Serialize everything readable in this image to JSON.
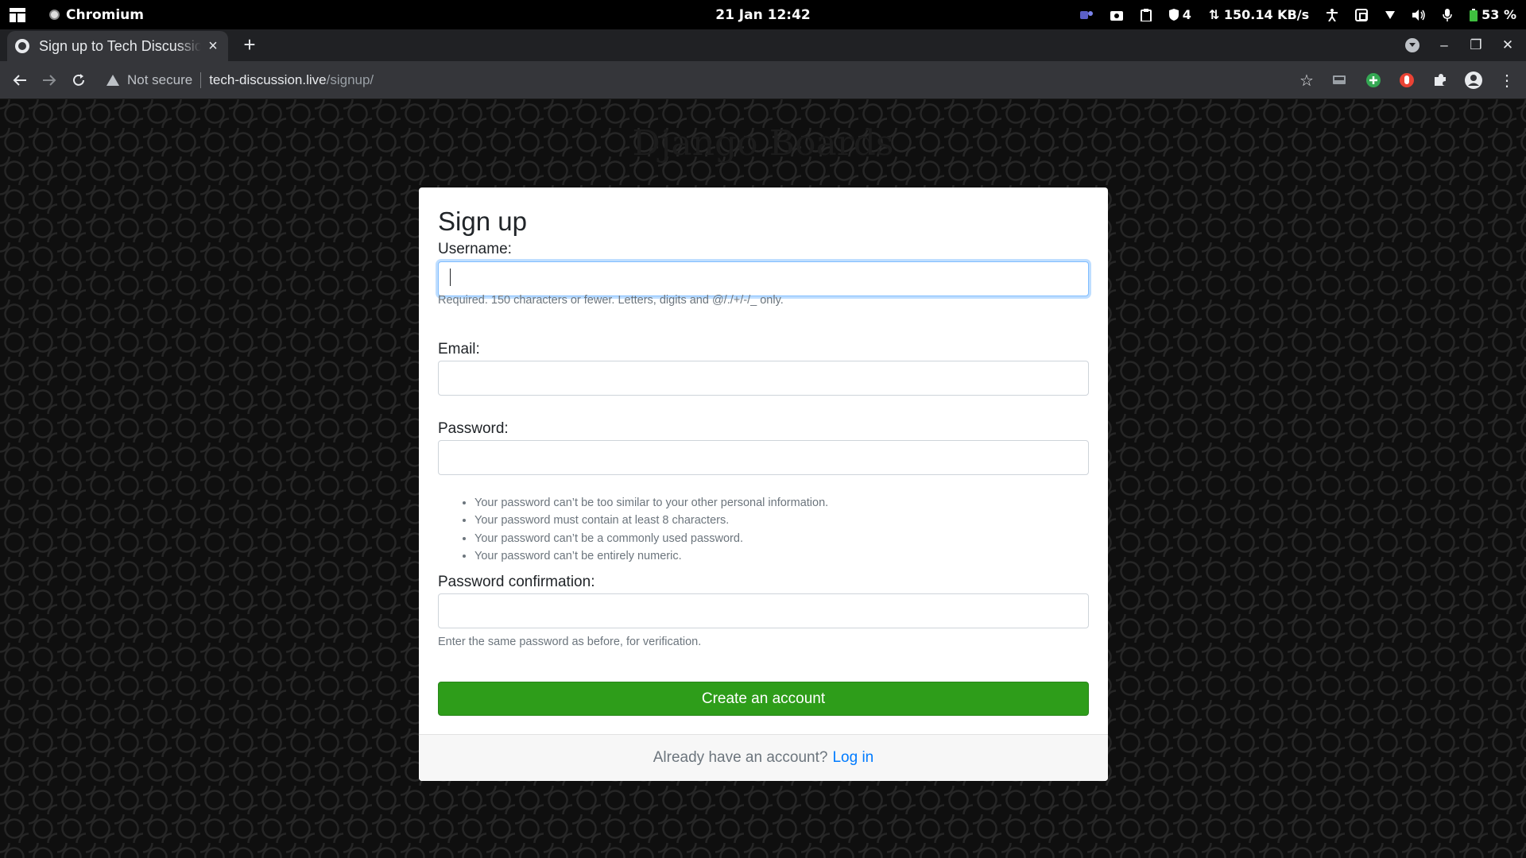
{
  "os_bar": {
    "active_app": "Chromium",
    "clock": "21 Jan  12:42",
    "tray": {
      "privacy_count": "4",
      "net_speed": "⇅ 150.14 KB/s",
      "battery": "53 %"
    }
  },
  "browser": {
    "tab_title": "Sign up to Tech Discussion",
    "tab_close": "×",
    "new_tab": "+",
    "security_label": "Not secure",
    "url_host": "tech-discussion.live",
    "url_path": "/signup/"
  },
  "page": {
    "brand": "Django Boards",
    "form": {
      "title": "Sign up",
      "username_label": "Username:",
      "username_value": "",
      "username_help": "Required. 150 characters or fewer. Letters, digits and @/./+/-/_ only.",
      "email_label": "Email:",
      "email_value": "",
      "password_label": "Password:",
      "password_value": "",
      "password_rules": [
        "Your password can’t be too similar to your other personal information.",
        "Your password must contain at least 8 characters.",
        "Your password can’t be a commonly used password.",
        "Your password can’t be entirely numeric."
      ],
      "password_confirm_label": "Password confirmation:",
      "password_confirm_value": "",
      "password_confirm_help": "Enter the same password as before, for verification.",
      "submit_label": "Create an account"
    },
    "footer": {
      "prompt": "Already have an account?",
      "login_link": "Log in"
    }
  },
  "colors": {
    "primary_button": "#2e9d1a",
    "link": "#007bff",
    "focus_ring": "#80bdff"
  }
}
